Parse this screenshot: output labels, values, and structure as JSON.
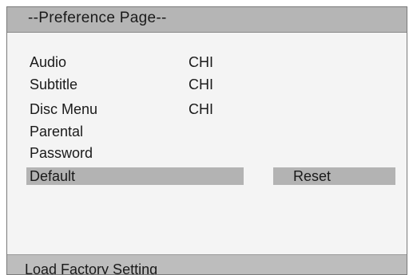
{
  "title": "--Preference Page--",
  "items": [
    {
      "label": "Audio",
      "value": "CHI"
    },
    {
      "label": "Subtitle",
      "value": "CHI"
    },
    {
      "label": "Disc Menu",
      "value": "CHI"
    },
    {
      "label": "Parental",
      "value": ""
    },
    {
      "label": "Password",
      "value": ""
    },
    {
      "label": "Default",
      "value": ""
    }
  ],
  "selected_item": "Default",
  "reset_option": "Reset",
  "status": "Load Factory Setting",
  "colors": {
    "title_bar": "#b5b5b5",
    "highlight": "#b3b3b3",
    "status_bar": "#bdbdbd",
    "background": "#f4f4f4"
  }
}
